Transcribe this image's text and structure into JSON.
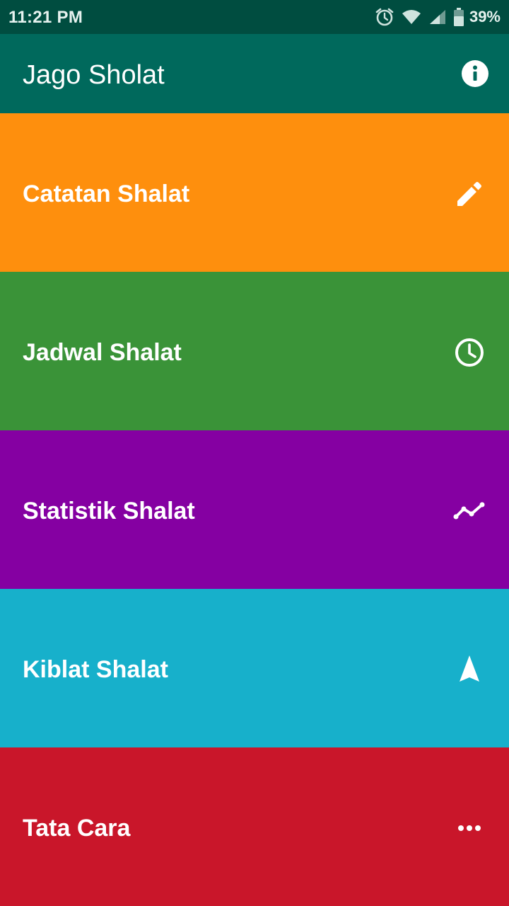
{
  "status_bar": {
    "time": "11:21 PM",
    "battery": "39%",
    "icons": [
      "alarm-icon",
      "wifi-icon",
      "signal-icon",
      "battery-icon"
    ]
  },
  "app_bar": {
    "title": "Jago Sholat",
    "action_icon": "info-icon"
  },
  "menu": {
    "items": [
      {
        "label": "Catatan Shalat",
        "icon": "pencil-icon",
        "color": "#fe8f0d"
      },
      {
        "label": "Jadwal Shalat",
        "icon": "clock-icon",
        "color": "#3a9338"
      },
      {
        "label": "Statistik Shalat",
        "icon": "trending-icon",
        "color": "#8500a2"
      },
      {
        "label": "Kiblat Shalat",
        "icon": "navigation-arrow-icon",
        "color": "#17b0cb"
      },
      {
        "label": "Tata Cara",
        "icon": "more-horizontal-icon",
        "color": "#c9162a"
      }
    ]
  },
  "colors": {
    "status_bar": "#004d40",
    "app_bar": "#00695c"
  }
}
